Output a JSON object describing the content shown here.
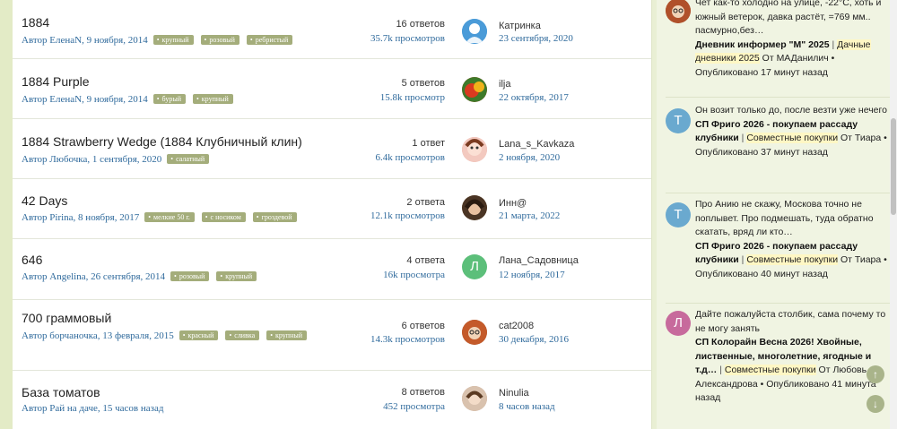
{
  "topics": [
    {
      "title": "1884",
      "author": "Автор ЕленаN, 9 ноября, 2014",
      "tags": [
        "крупный",
        "розовый",
        "ребристый"
      ],
      "replies": "16 ответов",
      "views": "35.7k просмотров",
      "last_user": "Катринка",
      "last_date": "23 сентября, 2020",
      "avatar_color": "#4a9bd8",
      "avatar_letter": ""
    },
    {
      "title": "1884 Purple",
      "author": "Автор ЕленаN, 9 ноября, 2014",
      "tags": [
        "бурый",
        "крупный"
      ],
      "replies": "5 ответов",
      "views": "15.8k просмотр",
      "last_user": "ilja",
      "last_date": "22 октября, 2017",
      "avatar_color": "#c7432b",
      "avatar_letter": ""
    },
    {
      "title": "1884 Strawberry Wedge (1884 Клубничный клин)",
      "author": "Автор Любочка, 1 сентября, 2020",
      "tags": [
        "салатный"
      ],
      "replies": "1 ответ",
      "views": "6.4k просмотров",
      "last_user": "Lana_s_Kavkaza",
      "last_date": "2 ноября, 2020",
      "avatar_color": "#e9a9a0",
      "avatar_letter": ""
    },
    {
      "title": "42 Days",
      "author": "Автор Pirina, 8 ноября, 2017",
      "tags": [
        "мелкие 50 г.",
        "с носиком",
        "гроздевой"
      ],
      "replies": "2 ответа",
      "views": "12.1k просмотров",
      "last_user": "Инн@",
      "last_date": "21 марта, 2022",
      "avatar_color": "#7a5a3a",
      "avatar_letter": ""
    },
    {
      "title": "646",
      "author": "Автор Angelina, 26 сентября, 2014",
      "tags": [
        "розовый",
        "крупный"
      ],
      "replies": "4 ответа",
      "views": "16k просмотра",
      "last_user": "Лана_Садовница",
      "last_date": "12 ноября, 2017",
      "avatar_color": "#5cbf7a",
      "avatar_letter": "Л"
    },
    {
      "title": "700 граммовый",
      "author": "Автор борчаночка, 13 февраля, 2015",
      "tags": [
        "красный",
        "сливка",
        "крупный"
      ],
      "replies": "6 ответов",
      "views": "14.3k просмотров",
      "last_user": "cat2008",
      "last_date": "30 декабря, 2016",
      "avatar_color": "#a0522d",
      "avatar_letter": ""
    },
    {
      "title": "База томатов",
      "author": "Автор Рай на даче, 15 часов назад",
      "tags": [],
      "replies": "8 ответов",
      "views": "452 просмотра",
      "last_user": "Ninulia",
      "last_date": "8 часов назад",
      "avatar_color": "#c8a48c",
      "avatar_letter": ""
    }
  ],
  "activity": [
    {
      "avatar_color": "#a0522d",
      "avatar_letter": "",
      "text": "Чет как-то холодно на улице, -22°C, хоть и южный ветерок, давка растёт, =769 мм.. пасмурно,без…",
      "thread": "Дневник информер \"М\" 2025",
      "forum": "Дачные дневники 2025",
      "author": "От МАДанилич",
      "time": "Опубликовано 17 минут назад"
    },
    {
      "avatar_color": "#6aa9cf",
      "avatar_letter": "Т",
      "text": "Он возит только до, после везти уже нечего",
      "thread": "СП Фриго 2026 - покупаем рассаду клубники",
      "forum": "Совместные покупки",
      "author": "От Тиара",
      "time": "Опубликовано 37 минут назад"
    },
    {
      "avatar_color": "#6aa9cf",
      "avatar_letter": "Т",
      "text": "Про Анию не скажу, Москова точно не поплывет. Про подмешать, туда обратно скатать, вряд ли кто…",
      "thread": "СП Фриго 2026 - покупаем рассаду клубники",
      "forum": "Совместные покупки",
      "author": "От Тиара",
      "time": "Опубликовано 40 минут назад"
    },
    {
      "avatar_color": "#c76a9c",
      "avatar_letter": "Л",
      "text": "Дайте пожалуйста столбик, сама почему то не могу занять",
      "thread": "СП Колорайн Весна 2026! Хвойные, лиственные, многолетние, ягодные и т.д…",
      "forum": "Совместные покупки",
      "author": "От Любовь Александрова",
      "time": "Опубликовано 41 минута назад"
    }
  ],
  "scroll": {
    "up_icon": "↑",
    "down_icon": "↓"
  }
}
